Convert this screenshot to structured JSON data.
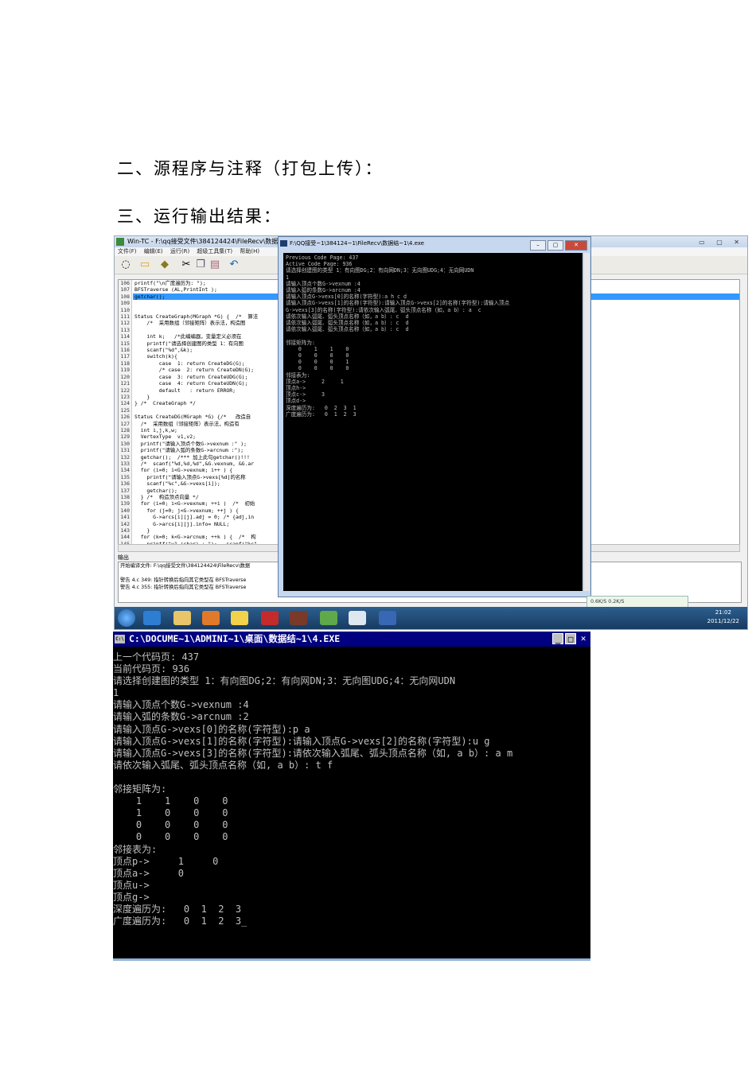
{
  "section2": "二、源程序与注释（打包上传）：",
  "section3": "三、运行输出结果：",
  "shot1": {
    "wintc_title": "Win-TC - F:\\qq接受文件\\384124424\\FileRecv\\数据结构实验",
    "menu": [
      "文件(F)",
      "编辑(E)",
      "运行(R)",
      "超级工具集(T)",
      "帮助(H)"
    ],
    "line_numbers": [
      "106",
      "107",
      "108",
      "109",
      "110",
      "111",
      "112",
      "113",
      "114",
      "115",
      "116",
      "117",
      "118",
      "119",
      "120",
      "121",
      "122",
      "123",
      "124",
      "125",
      "126",
      "127",
      "128",
      "129",
      "130",
      "131",
      "132",
      "133",
      "134",
      "135",
      "136",
      "137",
      "138",
      "139",
      "140",
      "141",
      "142",
      "143",
      "144",
      "145"
    ],
    "code_lines": [
      "printf(\"\\n广度遍历为: \");",
      "BFSTraverse (AL,PrintInt );",
      "getchar();",
      "",
      "",
      "Status CreateGraph(MGraph *G) {  /*  算法",
      "    /*  采用数组（邻接矩阵）表示法，构造图",
      "",
      "    int k;   /*此编编器，变量定义必须在",
      "    printf(\"请选择创建图的类型 1：有向图",
      "    scanf(\"%d\",&k);",
      "    switch(k){",
      "        case  1: return CreateDG(G);",
      "        /* case  2: return CreateDN(G);",
      "        case  3: return CreateUDG(G);",
      "        case  4: return CreateUDN(G);",
      "        default   : return ERROR;",
      "    }",
      "} /*  CreateGraph */",
      "",
      "Status CreateDG(MGraph *G) {/*   改造自",
      "  /*  采用数组（邻接矩阵）表示法，构造有",
      "  int i,j,k,w;",
      "  VertexType  v1,v2;",
      "  printf(\"请输入顶点个数G->vexnum :\" );",
      "  printf(\"请输入弧的条数G->arcnum :\");",
      "  getchar();  /*** 加上此句getchar()!!!",
      "  /*  scanf(\"%d,%d,%d\",&G.vexnum, &G.ar",
      "  for (i=0; i<G->vexnum; i++ ) {",
      "    printf(\"请输入顶点G->vexs[%d]的名称",
      "    scanf(\"%c\",&G->vexs[i]);",
      "    getchar();",
      "  } /*  构造顶点向量 */",
      "  for (i=0; i<G->vexnum; ++i )  /*  初始",
      "    for (j=0; j<G->vexnum; ++j ) {",
      "      G->arcs[i][j].adj = 0; /* {adj,in",
      "      G->arcs[i][j].info= NULL;",
      "    }",
      "  for (k=0; k<G->arcnum; ++k ) {  /*  构",
      "    printf(\"v1 (char) : \");   scanf(\"%c\""
    ],
    "output_label": "输出",
    "output_lines": [
      "开始编译文件: F:\\qq接受文件\\384124424\\FileRecv\\数据",
      "",
      "警告 4.c 349: 指针转换后指向其它类型在 BFSTraverse",
      "警告 4.c 355: 指针转换后指向其它类型在 BFSTraverse"
    ],
    "console_title": "F:\\QQ接受~1\\384124~1\\FileRecv\\数据结~1\\4.exe",
    "console_lines": [
      "Previous Code Page: 437",
      "Active Code Page: 936",
      "请选择创建图的类型 1：有向图DG;2：有向网DN;3：无向图UDG;4：无向网UDN",
      "1",
      "请输入顶点个数G->vexnum :4",
      "请输入弧的条数G->arcnum :4",
      "请输入顶点G->vexs[0]的名称(字符型):a h c d",
      "请输入顶点G->vexs[1]的名称(字符型):请输入顶点G->vexs[2]的名称(字符型):请输入顶点",
      "G->vexs[3]的名称(字符型):请依次输入弧尾、弧头顶点名称（如，a b）: a  c",
      "请依次输入弧尾、弧头顶点名称（如，a b）: c  d",
      "请依次输入弧尾、弧头顶点名称（如，a b）: c  d",
      "请依次输入弧尾、弧头顶点名称（如，a b）: c  d",
      "",
      "邻接矩阵为:",
      "    0    1    1    0",
      "    0    0    0    0",
      "    0    0    0    1",
      "    0    0    0    0",
      "邻接表为:",
      "顶点a->     2     1",
      "顶点h->",
      "顶点c->     3",
      "顶点d->",
      "深度遍历为:   0  2  3  1",
      "广度遍历为:   0  1  2  3"
    ],
    "speed": "0.6K/S   0.2K/S",
    "clock_time": "21:02",
    "clock_date": "2011/12/22"
  },
  "console2": {
    "title": "C:\\DOCUME~1\\ADMINI~1\\桌面\\数据结~1\\4.EXE",
    "lines": [
      "上一个代码页: 437",
      "当前代码页: 936",
      "请选择创建图的类型 1：有向图DG;2：有向网DN;3：无向图UDG;4：无向网UDN",
      "1",
      "请输入顶点个数G->vexnum :4",
      "请输入弧的条数G->arcnum :2",
      "请输入顶点G->vexs[0]的名称(字符型):p a",
      "请输入顶点G->vexs[1]的名称(字符型):请输入顶点G->vexs[2]的名称(字符型):u g",
      "请输入顶点G->vexs[3]的名称(字符型):请依次输入弧尾、弧头顶点名称（如, a b）: a m",
      "请依次输入弧尾、弧头顶点名称（如, a b）: t f",
      "",
      "邻接矩阵为:",
      "    1    1    0    0",
      "    1    0    0    0",
      "    0    0    0    0",
      "    0    0    0    0",
      "邻接表为:",
      "顶点p->     1     0",
      "顶点a->     0",
      "顶点u->",
      "顶点g->",
      "深度遍历为:   0  1  2  3",
      "广度遍历为:   0  1  2  3_"
    ]
  }
}
